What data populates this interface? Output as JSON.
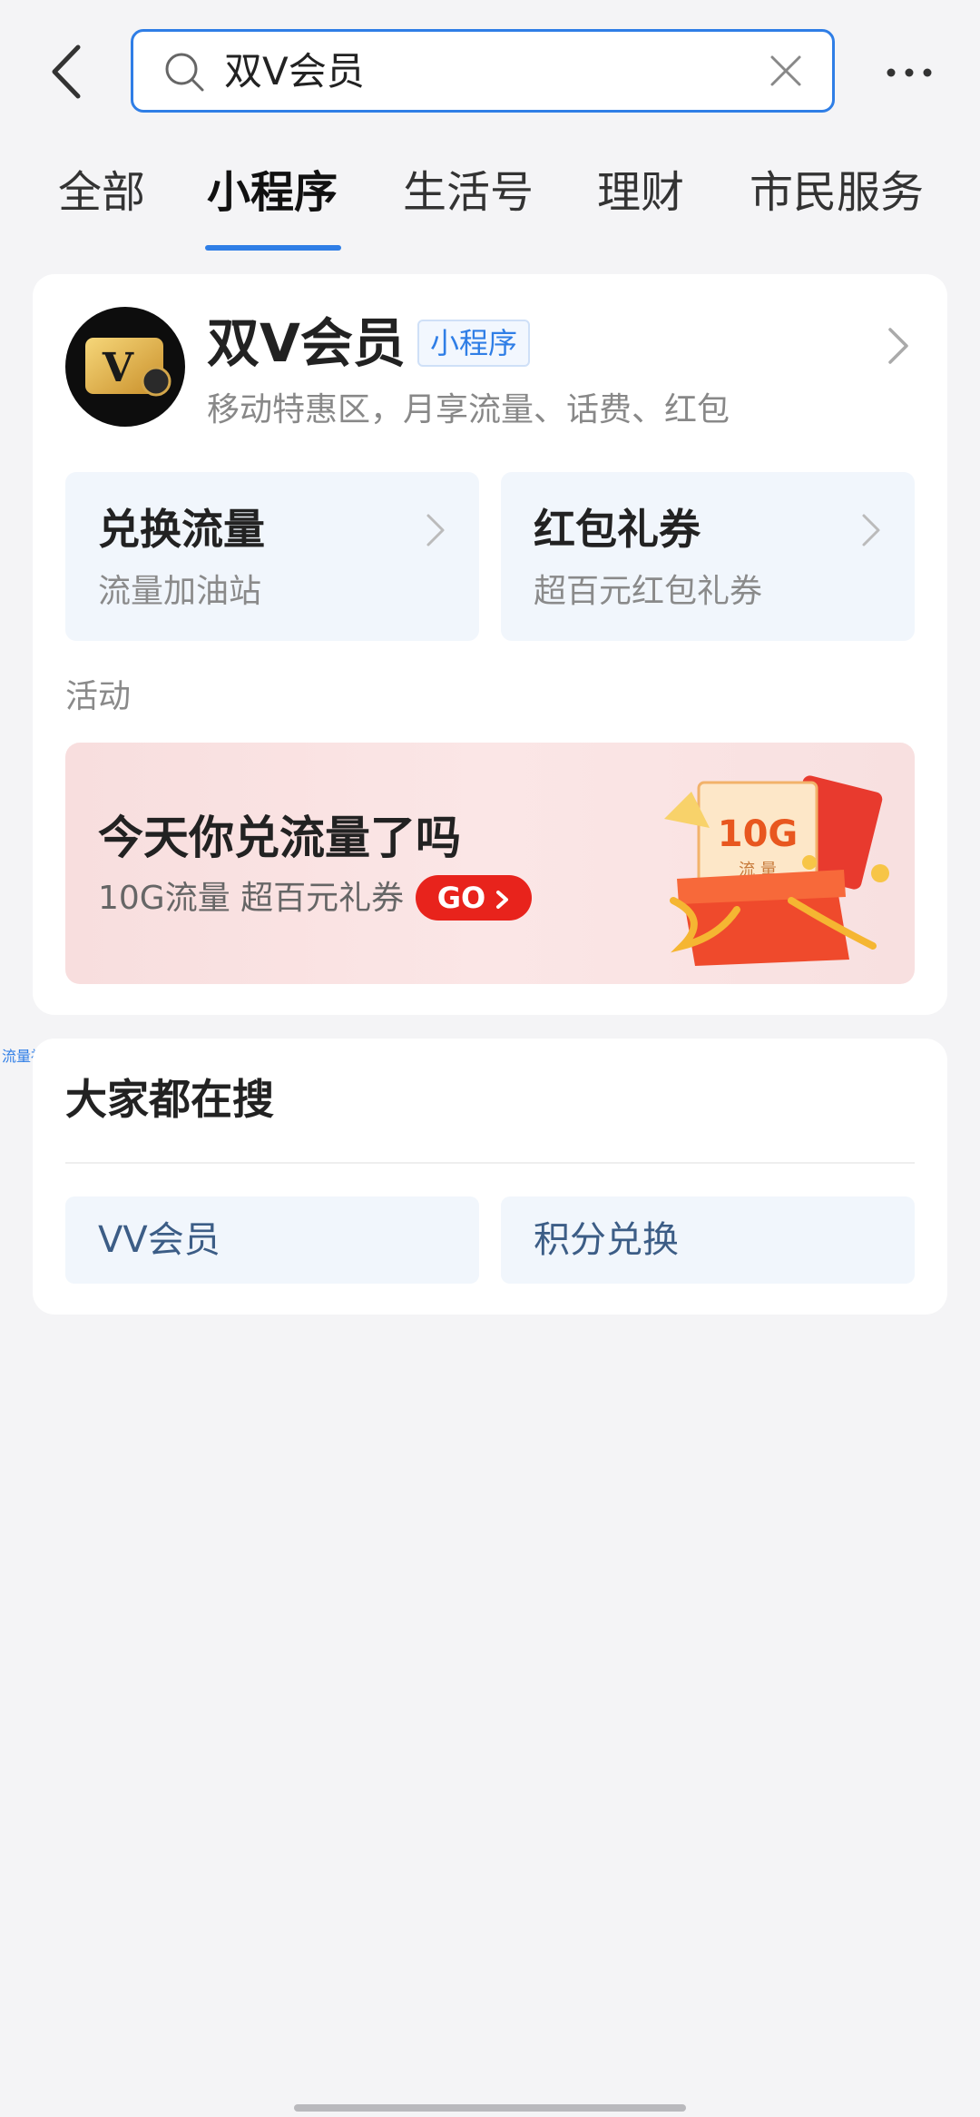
{
  "search": {
    "query": "双V会员"
  },
  "tabs": [
    {
      "label": "全部"
    },
    {
      "label": "小程序"
    },
    {
      "label": "生活号"
    },
    {
      "label": "理财"
    },
    {
      "label": "市民服务"
    }
  ],
  "active_tab": 1,
  "result": {
    "name": "双V会员",
    "badge": "小程序",
    "description": "移动特惠区，月享流量、话费、红包",
    "logo_letter": "V",
    "services": [
      {
        "title": "兑换流量",
        "subtitle": "流量加油站"
      },
      {
        "title": "红包礼券",
        "subtitle": "超百元红包礼券"
      }
    ],
    "activity_label": "活动",
    "banner": {
      "title": "今天你兑流量了吗",
      "subtitle": "10G流量 超百元礼券",
      "go": "GO",
      "gift_text": "10G",
      "gift_sub": "流 量"
    }
  },
  "tiny_label": "流量社区",
  "popular": {
    "title": "大家都在搜",
    "items": [
      {
        "label": "VV会员"
      },
      {
        "label": "积分兑换"
      }
    ]
  },
  "colors": {
    "accent": "#2f7ee6",
    "go": "#e8231c"
  }
}
